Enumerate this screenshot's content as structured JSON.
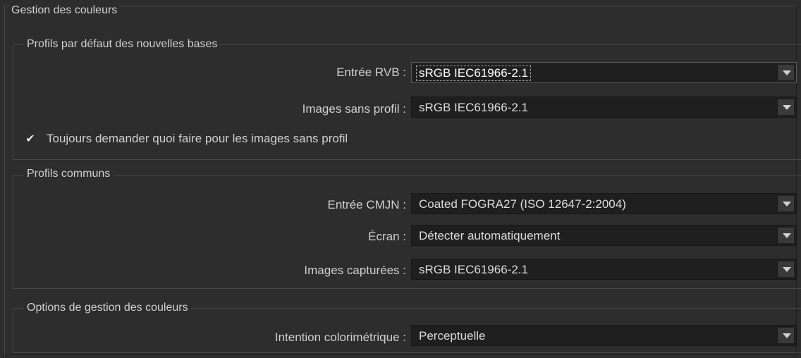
{
  "panel": {
    "title": "Gestion des couleurs"
  },
  "default_profiles": {
    "title": "Profils par défaut des nouvelles bases",
    "rgb_input": {
      "label": "Entrée RVB :",
      "value": "sRGB IEC61966-2.1"
    },
    "untagged_images": {
      "label": "Images sans profil :",
      "value": "sRGB IEC61966-2.1"
    },
    "always_ask": {
      "label": "Toujours demander quoi faire pour les images sans profil",
      "checked": true
    }
  },
  "common_profiles": {
    "title": "Profils communs",
    "cmyk_input": {
      "label": "Entrée CMJN :",
      "value": "Coated FOGRA27 (ISO 12647-2:2004)"
    },
    "display": {
      "label": "Écran :",
      "value": "Détecter automatiquement"
    },
    "captured_images": {
      "label": "Images capturées :",
      "value": "sRGB IEC61966-2.1"
    }
  },
  "color_management_options": {
    "title": "Options de gestion des couleurs",
    "rendering_intent": {
      "label": "Intention colorimétrique :",
      "value": "Perceptuelle"
    }
  },
  "colors": {
    "background": "#2d2d2d",
    "field_background": "#1f1f1f",
    "text": "#d8d8d8"
  },
  "icons": {
    "dropdown": "chevron-down-icon",
    "check": "checkmark-icon"
  }
}
